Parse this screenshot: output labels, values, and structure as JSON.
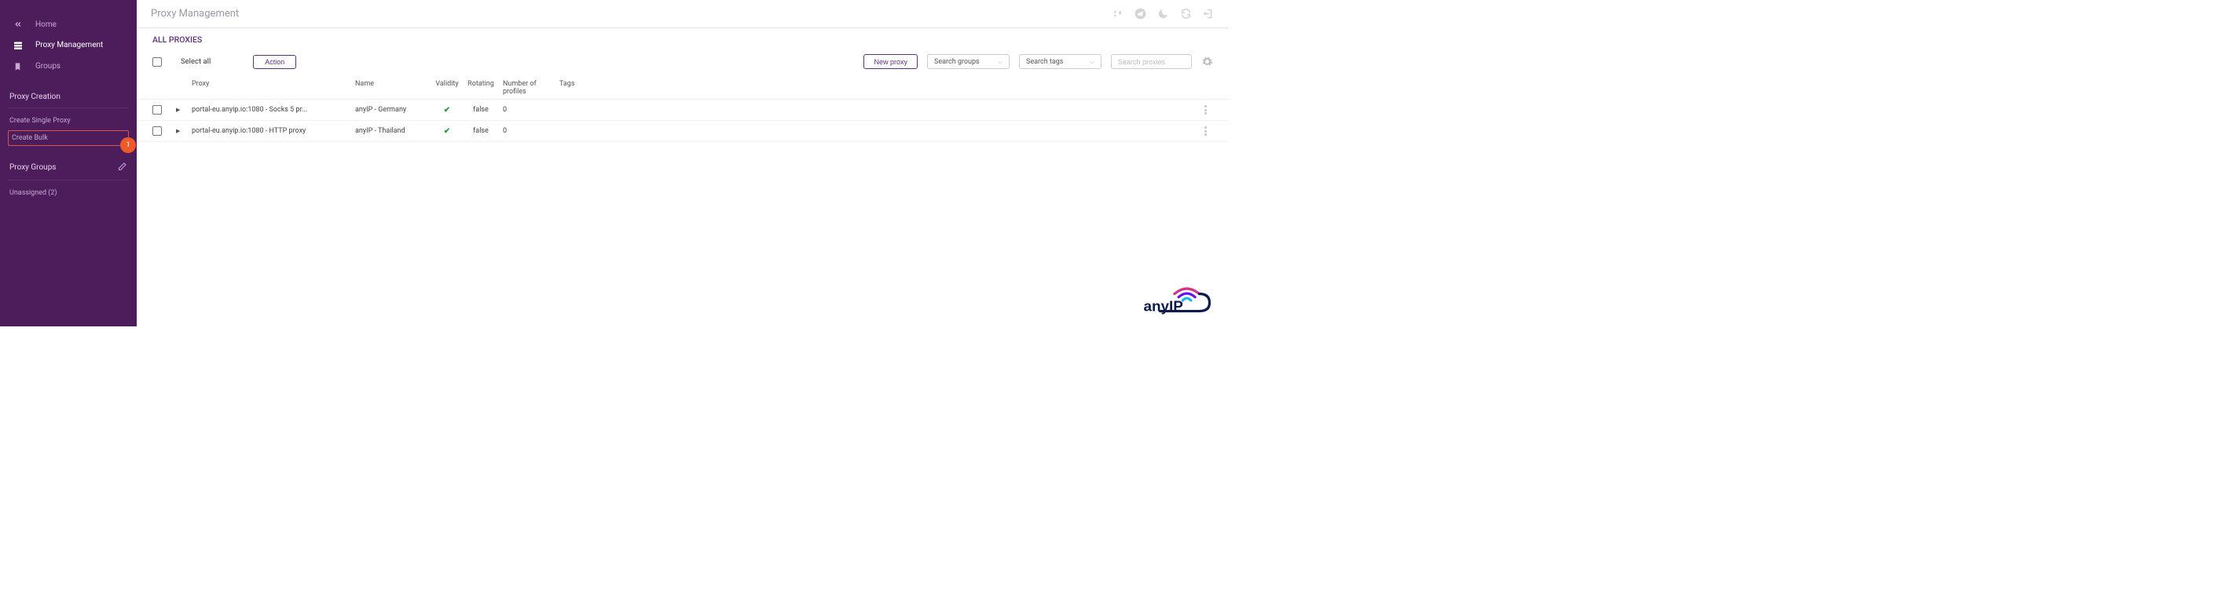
{
  "sidebar": {
    "home": "Home",
    "proxy_management": "Proxy Management",
    "groups": "Groups",
    "section_creation": "Proxy Creation",
    "create_single": "Create Single Proxy",
    "create_bulk": "Create Bulk",
    "badge_create_bulk": "1",
    "section_groups": "Proxy Groups",
    "unassigned": "Unassigned (2)"
  },
  "header": {
    "title": "Proxy Management"
  },
  "section_title": "ALL PROXIES",
  "toolbar": {
    "select_all": "Select all",
    "action": "Action",
    "new_proxy": "New proxy",
    "search_groups": "Search groups",
    "search_tags": "Search tags",
    "search_proxies_placeholder": "Search proxies"
  },
  "columns": {
    "proxy": "Proxy",
    "name": "Name",
    "validity": "Validity",
    "rotating": "Rotating",
    "profiles": "Number of profiles",
    "tags": "Tags"
  },
  "rows": [
    {
      "proxy": "portal-eu.anyip.io:1080 - Socks 5 pr...",
      "name": "anyIP - Germany",
      "validity": "✔",
      "rotating": "false",
      "profiles": "0",
      "tags": ""
    },
    {
      "proxy": "portal-eu.anyip.io:1080 - HTTP proxy",
      "name": "anyIP - Thailand",
      "validity": "✔",
      "rotating": "false",
      "profiles": "0",
      "tags": ""
    }
  ]
}
